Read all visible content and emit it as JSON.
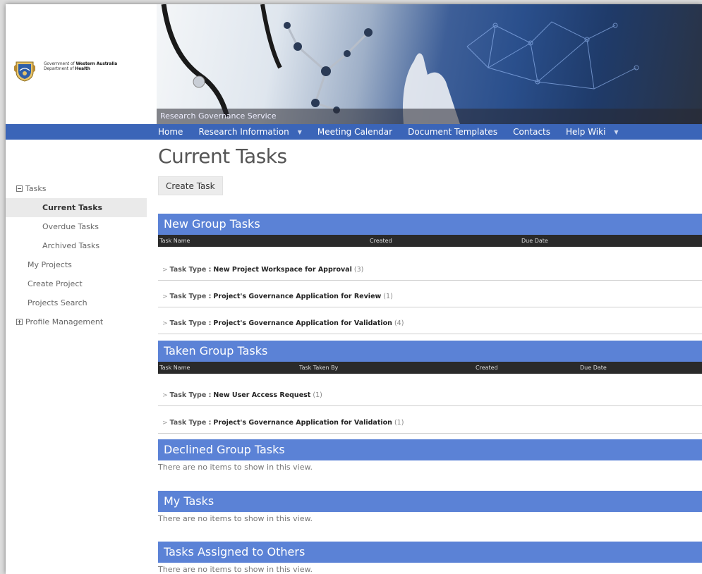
{
  "header": {
    "gov_line1_prefix": "Government of ",
    "gov_line1_bold": "Western Australia",
    "gov_line2_prefix": "Department of ",
    "gov_line2_bold": "Health",
    "banner_caption": "Research Governance Service"
  },
  "nav": {
    "items": [
      {
        "label": "Home",
        "has_menu": false
      },
      {
        "label": "Research Information",
        "has_menu": true
      },
      {
        "label": "Meeting Calendar",
        "has_menu": false
      },
      {
        "label": "Document Templates",
        "has_menu": false
      },
      {
        "label": "Contacts",
        "has_menu": false
      },
      {
        "label": "Help Wiki",
        "has_menu": true
      }
    ]
  },
  "leftnav": {
    "tasks": "Tasks",
    "current_tasks": "Current Tasks",
    "overdue_tasks": "Overdue Tasks",
    "archived_tasks": "Archived Tasks",
    "my_projects": "My Projects",
    "create_project": "Create Project",
    "projects_search": "Projects Search",
    "profile_management": "Profile Management"
  },
  "main": {
    "title": "Current Tasks",
    "create_button": "Create Task",
    "new_group": {
      "title": "New Group Tasks",
      "columns": [
        "Task Name",
        "Created",
        "Due Date"
      ],
      "rows": [
        {
          "label": "Task Type :",
          "name": "New Project Workspace for Approval",
          "count": "(3)"
        },
        {
          "label": "Task Type :",
          "name": "Project's Governance Application for Review",
          "count": "(1)"
        },
        {
          "label": "Task Type :",
          "name": "Project's Governance Application for Validation",
          "count": "(4)"
        }
      ]
    },
    "taken_group": {
      "title": "Taken Group Tasks",
      "columns": [
        "Task Name",
        "Task Taken By",
        "Created",
        "Due Date"
      ],
      "rows": [
        {
          "label": "Task Type :",
          "name": "New User Access Request",
          "count": "(1)"
        },
        {
          "label": "Task Type :",
          "name": "Project's Governance Application for Validation",
          "count": "(1)"
        }
      ]
    },
    "declined_group": {
      "title": "Declined Group Tasks",
      "empty": "There are no items to show in this view."
    },
    "my_tasks": {
      "title": "My Tasks",
      "empty": "There are no items to show in this view."
    },
    "assigned_others": {
      "title": "Tasks Assigned to Others",
      "empty": "There are no items to show in this view."
    }
  },
  "colors": {
    "nav_bar": "#3b65b8",
    "section_header": "#5b82d6",
    "column_header": "#2a2a2a"
  }
}
